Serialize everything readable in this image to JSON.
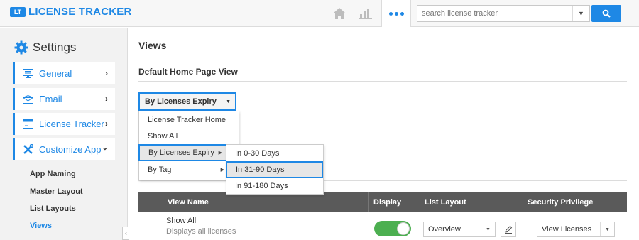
{
  "header": {
    "logo_text": "LT",
    "app_title": "LICENSE TRACKER",
    "icons": [
      "home-icon",
      "bar-chart-icon",
      "more-dots-icon"
    ],
    "search": {
      "placeholder": "search license tracker"
    }
  },
  "sidebar": {
    "title": "Settings",
    "items": [
      {
        "label": "General",
        "icon": "monitor-icon"
      },
      {
        "label": "Email",
        "icon": "envelope-icon"
      },
      {
        "label": "License Tracker",
        "icon": "window-icon"
      },
      {
        "label": "Customize App",
        "icon": "tools-icon"
      }
    ],
    "sub_items": [
      "App Naming",
      "Master Layout",
      "List Layouts",
      "Views"
    ],
    "active_sub_item": "Views"
  },
  "main": {
    "title": "Views",
    "section_title": "Default Home Page View",
    "dropdown": {
      "selected": "By Licenses Expiry",
      "options": [
        "License Tracker Home",
        "Show All",
        "By Licenses Expiry",
        "By Tag"
      ],
      "submenu": [
        "In 0-30 Days",
        "In 31-90 Days",
        "In 91-180 Days"
      ]
    },
    "table": {
      "columns": [
        "View Name",
        "Display",
        "List Layout",
        "Security Privilege"
      ],
      "rows": [
        {
          "name": "Show All",
          "description": "Displays all licenses",
          "display": true,
          "list_layout": "Overview",
          "security_privilege": "View Licenses"
        }
      ]
    }
  },
  "colors": {
    "accent": "#1e88e5",
    "toggle_on": "#4caf50",
    "table_header": "#5a5a5a"
  }
}
